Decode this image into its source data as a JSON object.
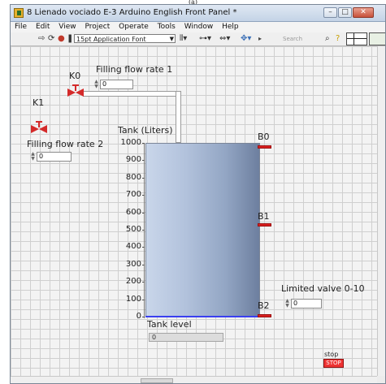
{
  "caption": "(a)",
  "window": {
    "title": "8 Lienado vociado E-3 Arduino English Front Panel *",
    "buttons": [
      "–",
      "□",
      "✕"
    ]
  },
  "menu": [
    "File",
    "Edit",
    "View",
    "Project",
    "Operate",
    "Tools",
    "Window",
    "Help"
  ],
  "toolbar": {
    "font_select": "15pt Application Font",
    "search_placeholder": "Search",
    "icons": [
      "run-arrow-icon",
      "run-continuous-icon",
      "abort-icon",
      "pause-icon",
      "align-icon",
      "distribute-icon",
      "resize-icon",
      "reorder-icon",
      "search-icon",
      "help-icon"
    ]
  },
  "panel": {
    "k0_label": "K0",
    "k1_label": "K1",
    "filling_rate_1_label": "Filling flow rate 1",
    "filling_rate_1_value": "0",
    "filling_rate_2_label": "Filling flow rate 2",
    "filling_rate_2_value": "0",
    "tank_label": "Tank (Liters)",
    "tank_scale": [
      "1000",
      "900",
      "800",
      "700",
      "600",
      "500",
      "400",
      "300",
      "200",
      "100",
      "0"
    ],
    "tank_level_fraction": 0,
    "b0_label": "B0",
    "b1_label": "B1",
    "b2_label": "B2",
    "limited_valve_label": "Limited valve 0-10",
    "limited_valve_value": "0",
    "tank_level_label": "Tank level",
    "tank_level_value": "0",
    "stop_label": "stop",
    "stop_button": "STOP"
  },
  "colors": {
    "valve": "#d42a2a",
    "led": "#d92020",
    "tank_fill": "#93a6c4"
  }
}
